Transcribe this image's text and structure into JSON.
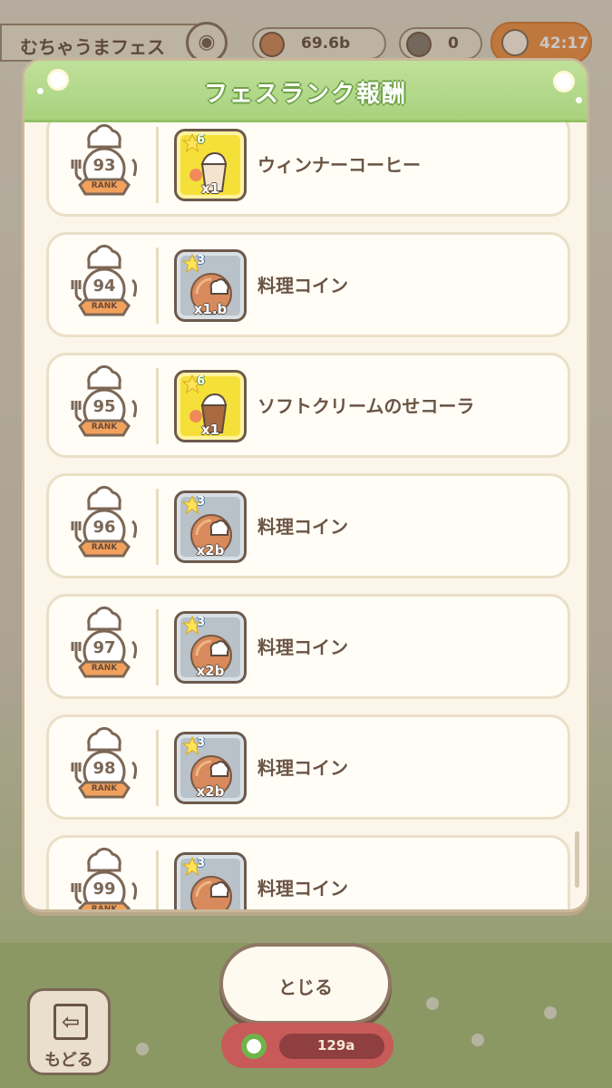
{
  "hud": {
    "fes_name": "むちゃうまフェス",
    "coins": "69.6b",
    "tickets": "0",
    "timer": "42:17"
  },
  "modal": {
    "title": "フェスランク報酬",
    "rewards": [
      {
        "rank": "93",
        "rank_label": "RANK",
        "name": "ウィンナーコーヒー",
        "quantity": "x1",
        "stars": "6",
        "tile": "gold",
        "icon": "vienna-coffee-icon"
      },
      {
        "rank": "94",
        "rank_label": "RANK",
        "name": "料理コイン",
        "quantity": "x1.b",
        "stars": "3",
        "tile": "grey",
        "icon": "cooking-coin-icon"
      },
      {
        "rank": "95",
        "rank_label": "RANK",
        "name": "ソフトクリームのせコーラ",
        "quantity": "x1",
        "stars": "6",
        "tile": "gold",
        "icon": "cola-float-icon"
      },
      {
        "rank": "96",
        "rank_label": "RANK",
        "name": "料理コイン",
        "quantity": "x2b",
        "stars": "3",
        "tile": "grey",
        "icon": "cooking-coin-icon"
      },
      {
        "rank": "97",
        "rank_label": "RANK",
        "name": "料理コイン",
        "quantity": "x2b",
        "stars": "3",
        "tile": "grey",
        "icon": "cooking-coin-icon"
      },
      {
        "rank": "98",
        "rank_label": "RANK",
        "name": "料理コイン",
        "quantity": "x2b",
        "stars": "3",
        "tile": "grey",
        "icon": "cooking-coin-icon"
      },
      {
        "rank": "99",
        "rank_label": "RANK",
        "name": "料理コイン",
        "quantity": "",
        "stars": "3",
        "tile": "grey",
        "icon": "cooking-coin-icon"
      }
    ],
    "close_label": "とじる"
  },
  "footer": {
    "back_label": "もどる",
    "counter": "129a"
  },
  "colors": {
    "header_green": "#a9d27e",
    "text_brown": "#6b5444",
    "gold_tile": "#f5e03a",
    "grey_tile": "#b9c2c9",
    "timer_orange": "#f09347"
  }
}
